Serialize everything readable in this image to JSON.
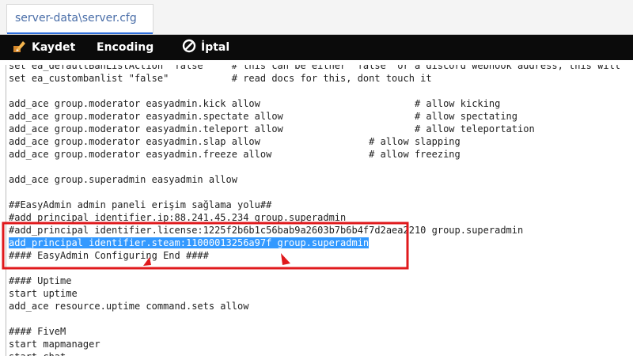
{
  "tab": {
    "title": "server-data\\server.cfg"
  },
  "toolbar": {
    "save_label": "Kaydet",
    "encoding_label": "Encoding",
    "cancel_label": "İptal"
  },
  "editor": {
    "lines": [
      "set ea_defaultBanListAction \"false\"    # this can be either \"false\" or a discord webhook address, this will",
      "set ea_custombanlist \"false\"           # read docs for this, dont touch it",
      "",
      "add_ace group.moderator easyadmin.kick allow                           # allow kicking",
      "add_ace group.moderator easyadmin.spectate allow                       # allow spectating",
      "add_ace group.moderator easyadmin.teleport allow                       # allow teleportation",
      "add_ace group.moderator easyadmin.slap allow                   # allow slapping",
      "add_ace group.moderator easyadmin.freeze allow                 # allow freezing",
      "",
      "add_ace group.superadmin easyadmin allow",
      "",
      "##EasyAdmin admin paneli erişim sağlama yolu##",
      "#add_principal identifier.ip:88.241.45.234 group.superadmin",
      "#add_principal identifier.license:1225f2b6b1c56bab9a2603b7b6b4f7d2aea2210 group.superadmin",
      "add_principal identifier.steam:11000013256a97f group.superadmin",
      "#### EasyAdmin Configuring End ####",
      "",
      "#### Uptime",
      "start uptime",
      "add_ace resource.uptime command.sets allow",
      "",
      "#### FiveM",
      "start mapmanager",
      "start chat"
    ],
    "selected_line_index": 14
  },
  "colors": {
    "selection": "#3399ff",
    "annotation": "#e0191c",
    "toolbar_bg": "#0b0b0b",
    "tab_text": "#4a6ea8"
  },
  "icons": {
    "save": "save-pen-icon",
    "cancel": "cancel-circle-slash-icon"
  }
}
